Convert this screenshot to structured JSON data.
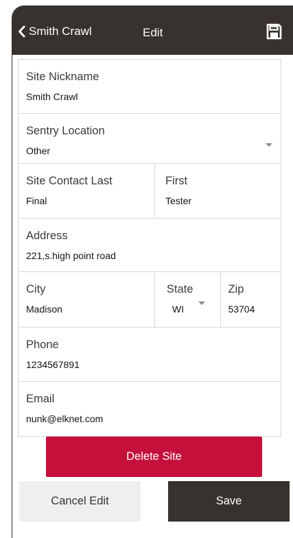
{
  "header": {
    "back_label": "Smith Crawl",
    "title": "Edit",
    "back_icon": "chevron-left-icon",
    "save_icon": "floppy-disk-icon"
  },
  "form": {
    "site_nickname": {
      "label": "Site Nickname",
      "value": "Smith Crawl"
    },
    "sentry_location": {
      "label": "Sentry Location",
      "value": "Other"
    },
    "contact_last": {
      "label": "Site Contact Last",
      "value": "Final"
    },
    "contact_first": {
      "label": "First",
      "value": "Tester"
    },
    "address": {
      "label": "Address",
      "value": "221,s.high point road"
    },
    "city": {
      "label": "City",
      "value": "Madison"
    },
    "state": {
      "label": "State",
      "value": "WI"
    },
    "zip": {
      "label": "Zip",
      "value": "53704"
    },
    "phone": {
      "label": "Phone",
      "value": "1234567891"
    },
    "email": {
      "label": "Email",
      "value": "nunk@elknet.com"
    }
  },
  "actions": {
    "delete_label": "Delete Site",
    "cancel_label": "Cancel Edit",
    "save_label": "Save"
  },
  "colors": {
    "header": "#38322e",
    "danger": "#c4103a",
    "secondary": "#efefef"
  }
}
